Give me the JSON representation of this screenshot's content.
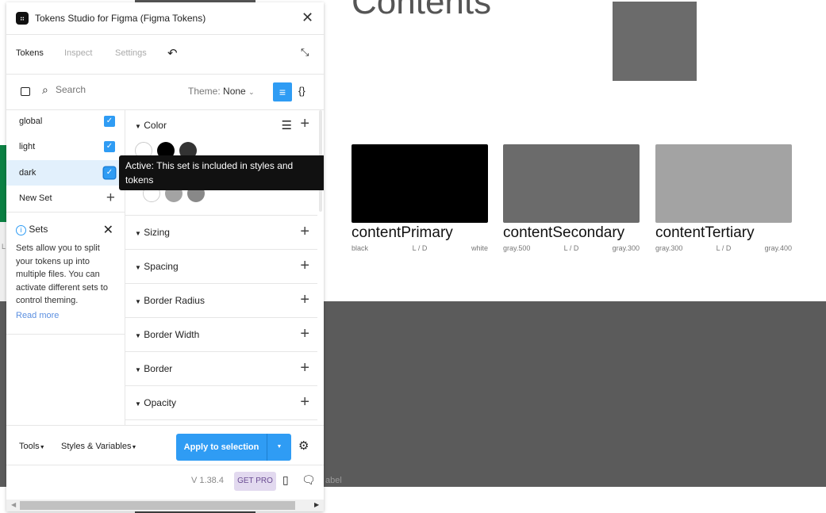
{
  "canvas": {
    "heading": "Contents",
    "label_fragment": "abel",
    "side_letter": "L",
    "cards": [
      {
        "name": "contentPrimary",
        "light": "black",
        "mode": "L / D",
        "dark": "white",
        "color": "#000000"
      },
      {
        "name": "contentSecondary",
        "light": "gray.500",
        "mode": "L / D",
        "dark": "gray.300",
        "color": "#6b6b6b"
      },
      {
        "name": "contentTertiary",
        "light": "gray.300",
        "mode": "L / D",
        "dark": "gray.400",
        "color": "#a3a3a3"
      }
    ]
  },
  "plugin": {
    "title": "Tokens Studio for Figma (Figma Tokens)",
    "tabs": [
      {
        "label": "Tokens",
        "active": true
      },
      {
        "label": "Inspect"
      },
      {
        "label": "Settings"
      }
    ],
    "search": {
      "placeholder": "Search"
    },
    "theme": {
      "label": "Theme:",
      "value": "None"
    },
    "sets": [
      {
        "name": "global",
        "checked": true
      },
      {
        "name": "light",
        "checked": true
      },
      {
        "name": "dark",
        "checked": true,
        "selected": true
      }
    ],
    "new_set": "New Set",
    "tooltip": "Active: This set is included in styles and tokens",
    "info": {
      "title": "Sets",
      "body": "Sets allow you to split your tokens up into multiple files. You can activate different sets to control theming.",
      "link": "Read more"
    },
    "groups": [
      "Color",
      "Sizing",
      "Spacing",
      "Border Radius",
      "Border Width",
      "Border",
      "Opacity"
    ],
    "footer": {
      "tools": "Tools",
      "styles": "Styles & Variables",
      "apply": "Apply to selection",
      "version": "V 1.38.4",
      "get_pro": "GET PRO"
    },
    "accent": "#2f9cf4"
  }
}
